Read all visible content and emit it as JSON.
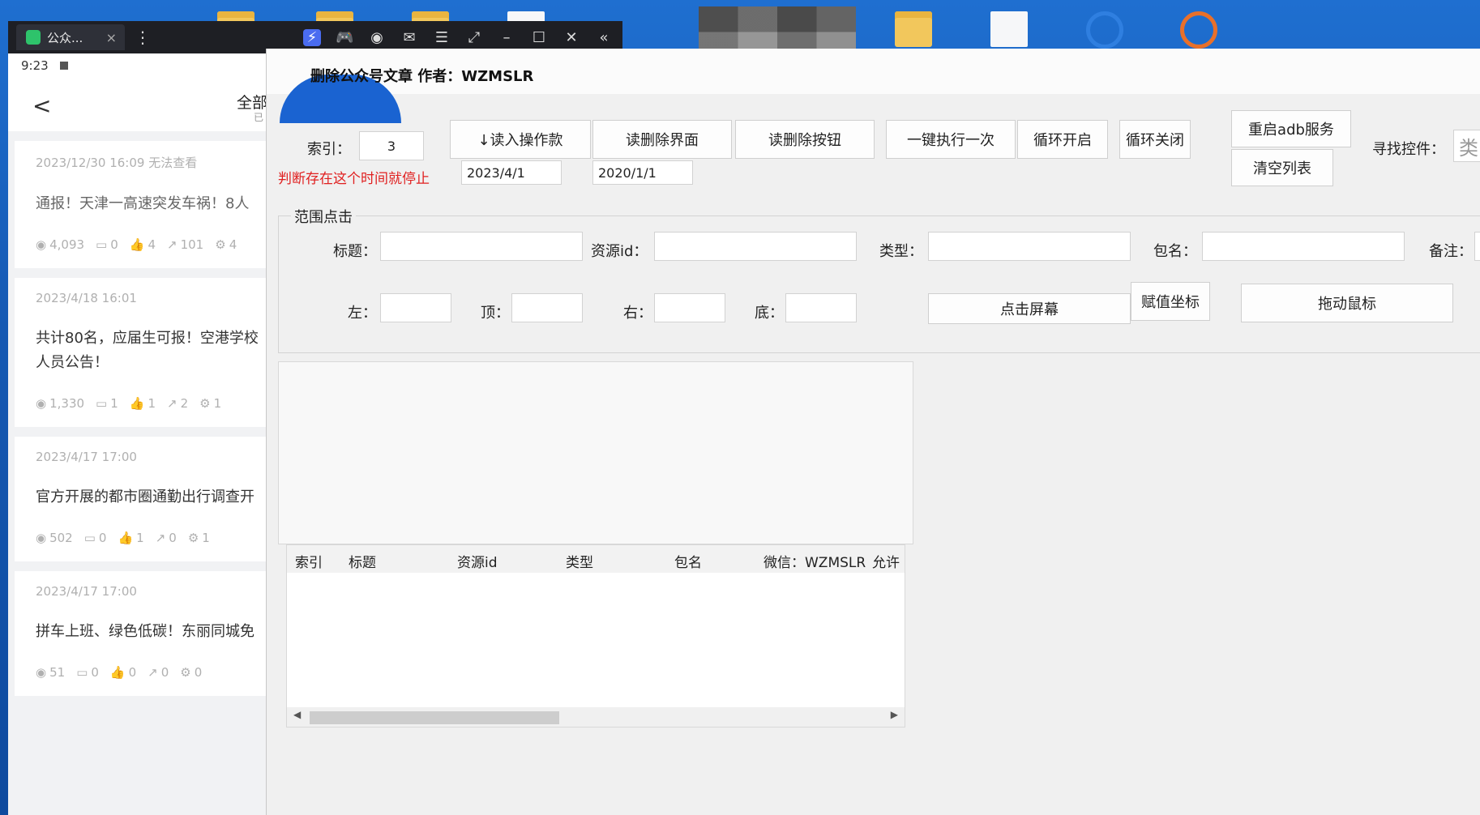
{
  "emulator": {
    "tab_label": "公众...",
    "tab_close": "×",
    "more": "⋮",
    "tools": [
      "⚡",
      "🎮",
      "◉",
      "✉",
      "☰",
      "⤢",
      "–",
      "☐",
      "✕",
      "«"
    ]
  },
  "phone": {
    "time": "9:23",
    "back": "<",
    "filter_label": "全部",
    "filter_sub": "已",
    "articles": [
      {
        "date": "2023/12/30 16:09   无法查看",
        "title": "通报！天津一高速突发车祸！8人",
        "views": "4,093",
        "comments": "0",
        "likes": "4",
        "shares": "101",
        "other": "4"
      },
      {
        "date": "2023/4/18 16:01",
        "title": "共计80名，应届生可报！空港学校",
        "title2": "人员公告！",
        "views": "1,330",
        "comments": "1",
        "likes": "1",
        "shares": "2",
        "other": "1"
      },
      {
        "date": "2023/4/17 17:00",
        "title": "官方开展的都市圈通勤出行调查开",
        "views": "502",
        "comments": "0",
        "likes": "1",
        "shares": "0",
        "other": "1"
      },
      {
        "date": "2023/4/17 17:00",
        "title": "拼车上班、绿色低碳！东丽同城免",
        "views": "51",
        "comments": "0",
        "likes": "0",
        "shares": "0",
        "other": "0"
      }
    ]
  },
  "app": {
    "title": "删除公众号文章  作者：WZMSLR",
    "index_label": "索引：",
    "index_value": "3",
    "stop_note": "判断存在这个时间就停止",
    "date1": "2023/4/1",
    "date2": "2020/1/1",
    "buttons": {
      "read_steps": "↓读入操作款",
      "read_delete_ui": "读删除界面",
      "read_delete_btn": "读删除按钮",
      "run_once": "一键执行一次",
      "loop_on": "循环开启",
      "loop_off": "循环关闭",
      "restart_adb": "重启adb服务",
      "clear_list": "清空列表",
      "click_screen": "点击屏幕",
      "assign_coords": "赋值坐标",
      "drag_mouse": "拖动鼠标"
    },
    "find_control_label": "寻找控件：",
    "find_control_value": "类",
    "group_title": "范围点击",
    "fields": {
      "title": "标题：",
      "resource_id": "资源id：",
      "type": "类型：",
      "package": "包名：",
      "note": "备注：",
      "left": "左：",
      "top": "顶：",
      "right": "右：",
      "bottom": "底："
    },
    "list_columns": [
      "索引",
      "标题",
      "资源id",
      "类型",
      "包名",
      "微信：WZMSLR",
      "允许"
    ]
  }
}
